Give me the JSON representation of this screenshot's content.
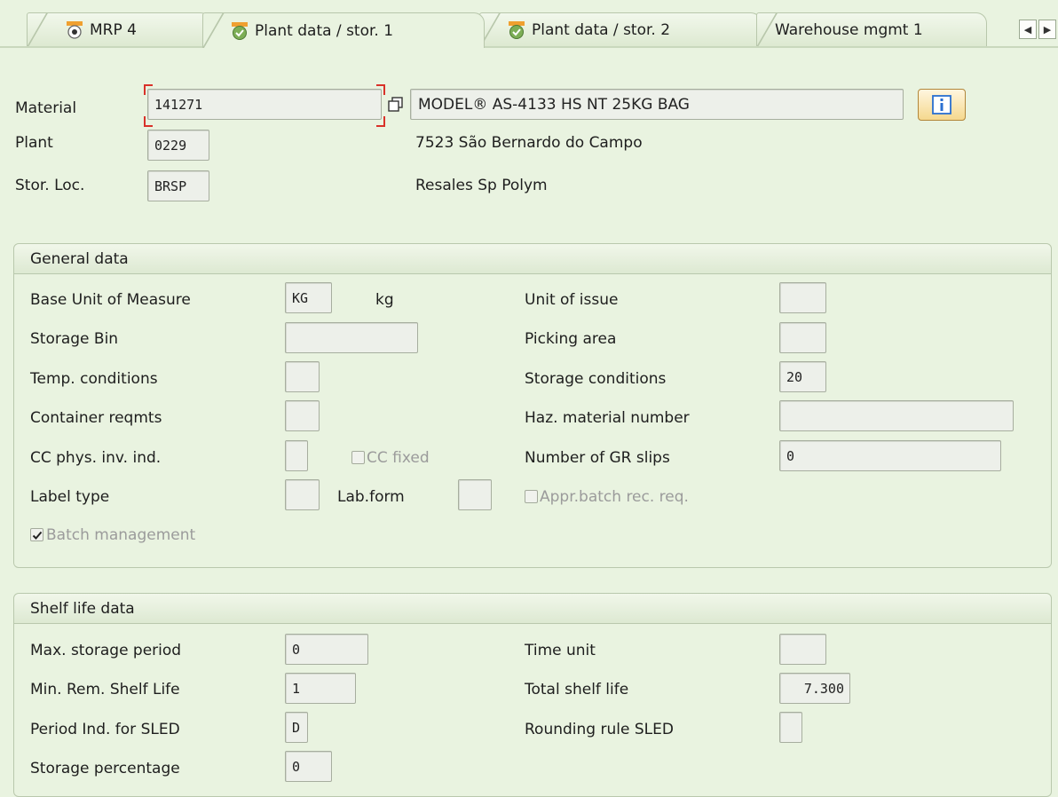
{
  "tabs": [
    {
      "label": "MRP 4",
      "icon": "radio-target-icon"
    },
    {
      "label": "Plant data / stor. 1",
      "icon": "check-status-icon"
    },
    {
      "label": "Plant data / stor. 2",
      "icon": "check-status-icon"
    },
    {
      "label": "Warehouse mgmt 1",
      "icon": ""
    }
  ],
  "header": {
    "material_label": "Material",
    "material_value": "141271",
    "material_desc": "MODEL® AS-4133 HS NT 25KG BAG",
    "plant_label": "Plant",
    "plant_value": "0229",
    "plant_desc": "7523 São Bernardo do Campo",
    "storloc_label": "Stor. Loc.",
    "storloc_value": "BRSP",
    "storloc_desc": "Resales Sp Polym"
  },
  "general": {
    "title": "General data",
    "base_uom_label": "Base Unit of Measure",
    "base_uom_value": "KG",
    "base_uom_text": "kg",
    "storage_bin_label": "Storage Bin",
    "storage_bin_value": "",
    "temp_cond_label": "Temp. conditions",
    "temp_cond_value": "",
    "container_label": "Container reqmts",
    "container_value": "",
    "cc_phys_label": "CC phys. inv. ind.",
    "cc_phys_value": "",
    "cc_fixed_label": "CC fixed",
    "cc_fixed_checked": false,
    "label_type_label": "Label type",
    "label_type_value": "",
    "lab_form_label": "Lab.form",
    "lab_form_value": "",
    "batch_mgmt_label": "Batch management",
    "batch_mgmt_checked": true,
    "unit_issue_label": "Unit of issue",
    "unit_issue_value": "",
    "picking_label": "Picking area",
    "picking_value": "",
    "storage_cond_label": "Storage conditions",
    "storage_cond_value": "20",
    "haz_label": "Haz. material number",
    "haz_value": "",
    "gr_slips_label": "Number of GR slips",
    "gr_slips_value": "0",
    "appr_batch_label": "Appr.batch rec. req.",
    "appr_batch_checked": false
  },
  "shelf": {
    "title": "Shelf life data",
    "max_storage_label": "Max. storage period",
    "max_storage_value": "0",
    "min_rem_label": "Min. Rem. Shelf Life",
    "min_rem_value": "1",
    "period_ind_label": "Period Ind. for SLED",
    "period_ind_value": "D",
    "storage_pct_label": "Storage percentage",
    "storage_pct_value": "0",
    "time_unit_label": "Time unit",
    "time_unit_value": "",
    "total_shelf_label": "Total shelf life",
    "total_shelf_value": "7.300",
    "rounding_label": "Rounding rule SLED",
    "rounding_value": ""
  },
  "colors": {
    "background": "#e9f3e0",
    "accent": "#f0a030",
    "required_marker": "#d9322a",
    "info_blue": "#2a6fd0"
  }
}
